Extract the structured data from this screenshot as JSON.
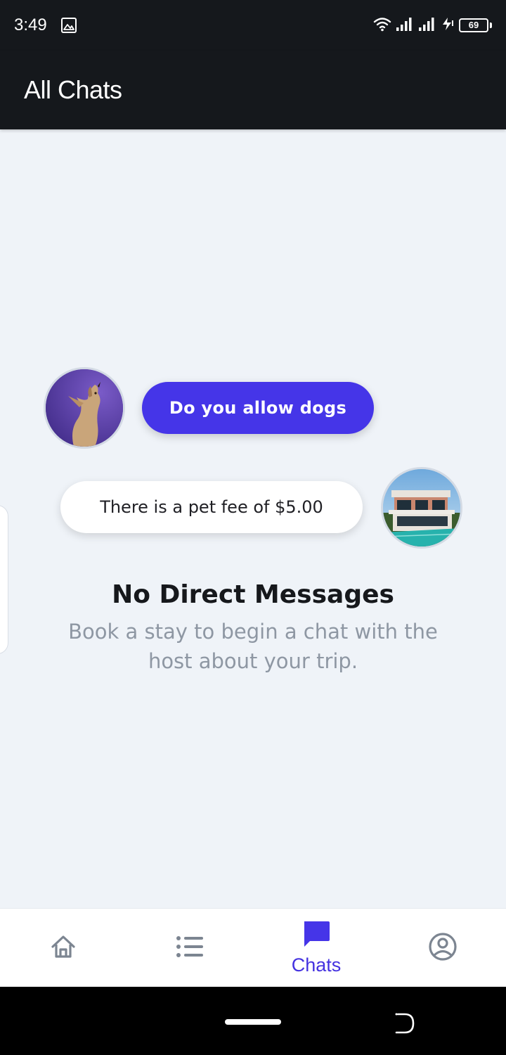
{
  "status_bar": {
    "time": "3:49",
    "battery_level": "69",
    "icons": [
      "gallery-icon",
      "wifi-icon",
      "signal-icon",
      "signal-icon",
      "charging-icon",
      "battery-icon"
    ]
  },
  "app_bar": {
    "title": "All Chats"
  },
  "illustration": {
    "question_bubble": "Do you allow dogs",
    "reply_bubble": "There is a pet fee of $5.00",
    "guest_avatar": "dog-avatar",
    "host_avatar": "house-avatar"
  },
  "empty_state": {
    "title": "No Direct Messages",
    "subtitle": "Book a stay to begin a chat with the host about your trip."
  },
  "bottom_nav": {
    "items": [
      {
        "icon": "home-icon",
        "label": "",
        "active": false
      },
      {
        "icon": "list-icon",
        "label": "",
        "active": false
      },
      {
        "icon": "chat-icon",
        "label": "Chats",
        "active": true
      },
      {
        "icon": "profile-icon",
        "label": "",
        "active": false
      }
    ]
  },
  "colors": {
    "accent": "#4535e8",
    "app_bar": "#15181c",
    "background": "#eff3f8",
    "inactive_icon": "#7c8591",
    "subtitle_text": "#8e97a3"
  }
}
